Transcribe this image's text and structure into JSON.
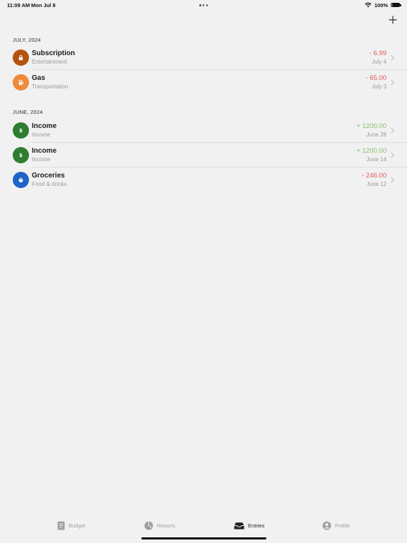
{
  "status_bar": {
    "time": "11:09 AM",
    "date": "Mon Jul 8",
    "battery": "100%"
  },
  "sections": [
    {
      "header": "JULY, 2024",
      "entries": [
        {
          "title": "Subscription",
          "category": "Entertainment",
          "amount": "- 6.99",
          "date": "July 4",
          "icon": "lock-icon",
          "icon_color": "#b5530f",
          "amount_color": "#e05a5a"
        },
        {
          "title": "Gas",
          "category": "Transportation",
          "amount": "- 65.00",
          "date": "July 3",
          "icon": "fuel-icon",
          "icon_color": "#ee8a3c",
          "amount_color": "#e05a5a"
        }
      ]
    },
    {
      "header": "JUNE, 2024",
      "entries": [
        {
          "title": "Income",
          "category": "Income",
          "amount": "+ 1200.00",
          "date": "June 28",
          "icon": "dollar-icon",
          "icon_color": "#2e7d32",
          "amount_color": "#86c06a"
        },
        {
          "title": "Income",
          "category": "Income",
          "amount": "+ 1200.00",
          "date": "June 14",
          "icon": "dollar-icon",
          "icon_color": "#2e7d32",
          "amount_color": "#86c06a"
        },
        {
          "title": "Groceries",
          "category": "Food & drinks",
          "amount": "- 246.00",
          "date": "June 12",
          "icon": "basket-icon",
          "icon_color": "#1f63c9",
          "amount_color": "#e05a5a"
        }
      ]
    }
  ],
  "tabs": [
    {
      "label": "Budget",
      "icon": "document-icon",
      "active": false
    },
    {
      "label": "Reports",
      "icon": "pie-chart-icon",
      "active": false
    },
    {
      "label": "Entries",
      "icon": "tray-icon",
      "active": true
    },
    {
      "label": "Profile",
      "icon": "person-icon",
      "active": false
    }
  ]
}
